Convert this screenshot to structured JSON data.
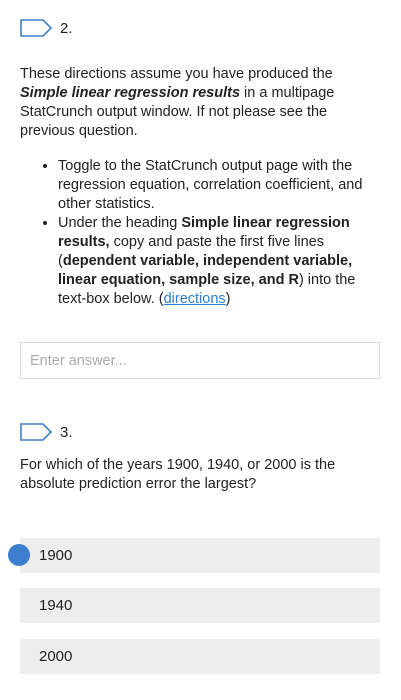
{
  "question2": {
    "number": "2.",
    "intro_part1": "These directions assume you have produced the ",
    "intro_bold": "Simple linear regression results",
    "intro_part2": " in a multipage StatCrunch output window. If not please see the previous question.",
    "bullet1": "Toggle to the StatCrunch output page with the regression equation, correlation coefficient, and other statistics.",
    "bullet2_part1": "Under the heading ",
    "bullet2_bold1": "Simple linear regression results,",
    "bullet2_part2": " copy and paste the first five lines (",
    "bullet2_bold2": "dependent variable, independent variable, linear equation, sample size, and R",
    "bullet2_part3": ") into the text-box below. (",
    "bullet2_link": "directions",
    "bullet2_part4": ")",
    "answer_placeholder": "Enter answer...",
    "answer_value": ""
  },
  "question3": {
    "number": "3.",
    "prompt": "For which of the years 1900, 1940, or 2000 is the absolute prediction error the largest?",
    "options": [
      "1900",
      "1940",
      "2000"
    ],
    "selected": "1900"
  },
  "colors": {
    "accent": "#3d7fcd",
    "link": "#2b7fd0",
    "option_bg": "#ededed"
  },
  "icons": {
    "question_flag": "flag-outline-icon"
  }
}
